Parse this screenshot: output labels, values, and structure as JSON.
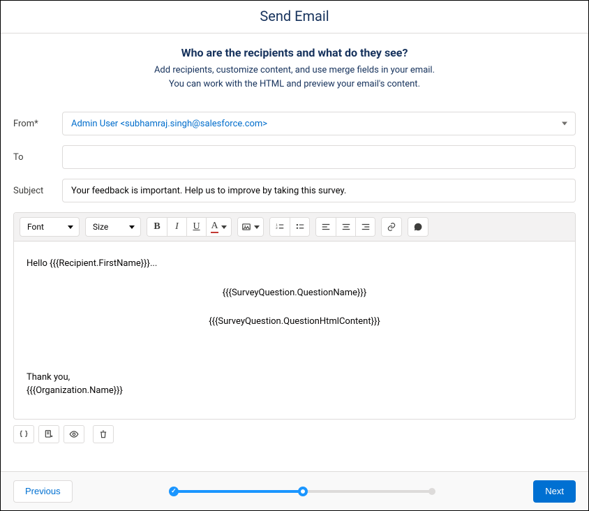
{
  "header": {
    "title": "Send Email"
  },
  "intro": {
    "heading": "Who are the recipients and what do they see?",
    "line1": "Add recipients, customize content, and use merge fields in your email.",
    "line2": "You can work with the HTML and preview your email's content."
  },
  "form": {
    "from_label": "From*",
    "from_value": "Admin User <subhamraj.singh@salesforce.com>",
    "to_label": "To",
    "to_value": "",
    "subject_label": "Subject",
    "subject_value": "Your feedback is important. Help us to improve by taking this survey."
  },
  "toolbar": {
    "font_label": "Font",
    "size_label": "Size"
  },
  "body": {
    "greeting": "Hello {{{Recipient.FirstName}}}...",
    "q_name": "{{{SurveyQuestion.QuestionName}}}",
    "q_html": "{{{SurveyQuestion.QuestionHtmlContent}}}",
    "thanks": "Thank you,",
    "org": "{{{Organization.Name}}}"
  },
  "footer": {
    "previous": "Previous",
    "next": "Next"
  }
}
